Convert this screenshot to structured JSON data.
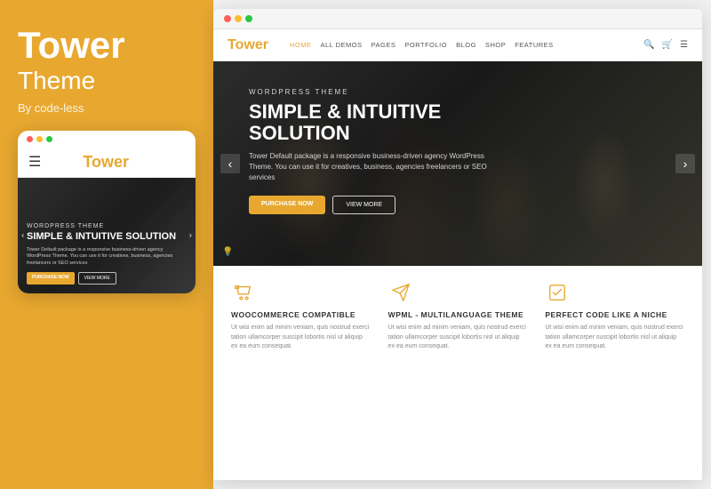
{
  "left": {
    "title": "Tower",
    "subtitle": "Theme",
    "by": "By code-less"
  },
  "mobile": {
    "logo_text": "ower",
    "logo_accent": "T",
    "hero_label": "WORDPRESS THEME",
    "hero_title": "SIMPLE & INTUITIVE SOLUTION",
    "hero_text": "Tower Default package is a responsive business-driven agency WordPress Theme. You can use it for creatives, business, agencies freelancers or SEO services",
    "btn_primary": "PURCHASE NOW",
    "btn_secondary": "VIEW MORE"
  },
  "desktop": {
    "logo_text": "ower",
    "logo_accent": "T",
    "nav_links": [
      "HOME",
      "ALL DEMOS",
      "PAGES",
      "PORTFOLIO",
      "BLOG",
      "SHOP",
      "FEATURES"
    ],
    "hero_label": "WORDPRESS THEME",
    "hero_title": "SIMPLE & INTUITIVE SOLUTION",
    "hero_desc": "Tower Default package is a responsive business-driven agency WordPress Theme. You can use it for creatives, business, agencies freelancers or SEO services",
    "btn_primary": "PURCHASE NOW",
    "btn_secondary": "VIEW MORE",
    "features": [
      {
        "title": "WOOCOMMERCE COMPATIBLE",
        "text": "Ut wisi enim ad minim veniam, quis nostrud exerci tation ullamcorper suscipit lobortis nisl ut aliquip ex ea eum consequat.",
        "icon": "cart"
      },
      {
        "title": "WPML - MULTILANGUAGE THEME",
        "text": "Ut wisi enim ad minim veniam, quis nostrud exerci tation ullamcorper suscipit lobortis nisl ut aliquip ex ea eum consequat.",
        "icon": "plane"
      },
      {
        "title": "PERFECT CODE LIKE A NICHE",
        "text": "Ut wisi enim ad minim veniam, quis nostrud exerci tation ullamcorper suscipit lobortis nisl ut aliquip ex ea eum consequat.",
        "icon": "check"
      }
    ]
  },
  "dots": {
    "red": "#FF5F57",
    "yellow": "#FEBC2E",
    "green": "#28C840"
  },
  "accent_color": "#E8A830"
}
